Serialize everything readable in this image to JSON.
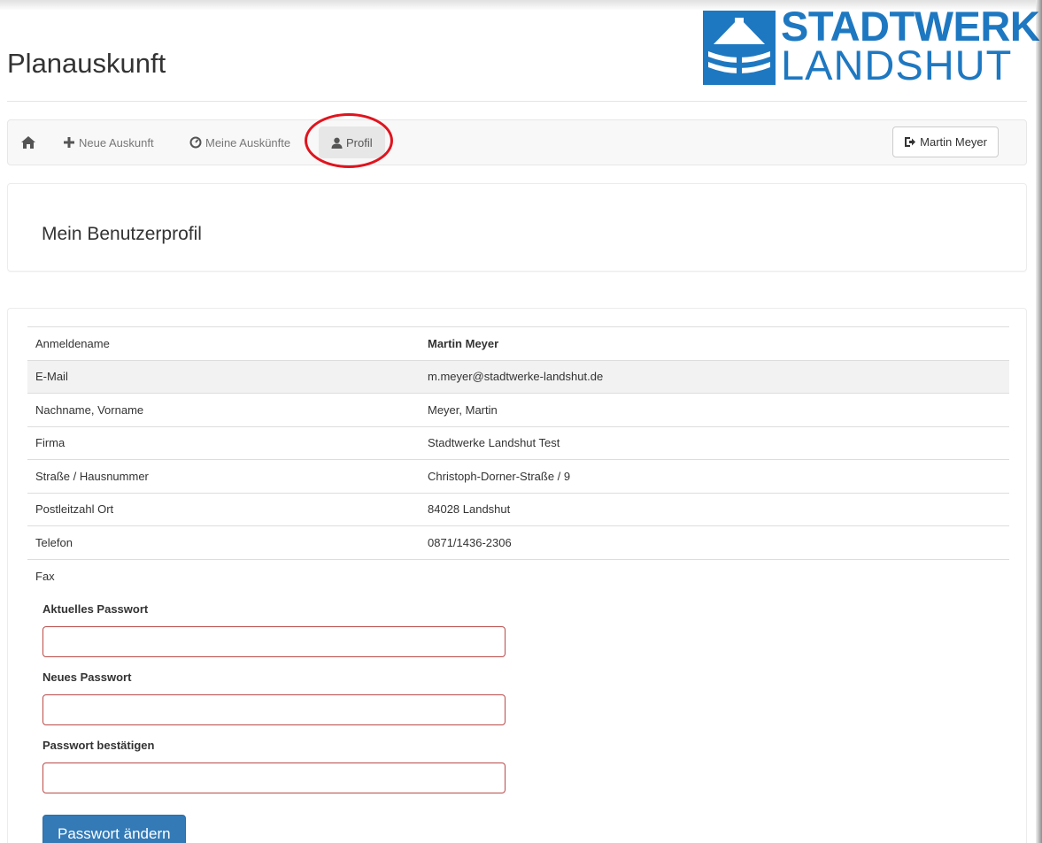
{
  "header": {
    "app_title": "Planauskunft",
    "logo_line1": "STADTWERKE",
    "logo_line2": "LANDSHUT"
  },
  "navbar": {
    "items": [
      {
        "label": "Neue Auskunft",
        "icon": "plus-icon"
      },
      {
        "label": "Meine Auskünfte",
        "icon": "dashboard-icon"
      },
      {
        "label": "Profil",
        "icon": "user-icon",
        "active": true
      }
    ],
    "user_button_label": "Martin Meyer",
    "user_button_icon": "logout-icon"
  },
  "page": {
    "heading": "Mein Benutzerprofil"
  },
  "profile": {
    "rows": [
      {
        "label": "Anmeldename",
        "value": "Martin Meyer"
      },
      {
        "label": "E-Mail",
        "value": "m.meyer@stadtwerke-landshut.de"
      },
      {
        "label": "Nachname, Vorname",
        "value": "Meyer, Martin"
      },
      {
        "label": "Firma",
        "value": "Stadtwerke Landshut Test"
      },
      {
        "label": "Straße / Hausnummer",
        "value": "Christoph-Dorner-Straße / 9"
      },
      {
        "label": "Postleitzahl Ort",
        "value": "84028 Landshut"
      },
      {
        "label": "Telefon",
        "value": "0871/1436-2306"
      },
      {
        "label": "Fax",
        "value": ""
      }
    ]
  },
  "password_form": {
    "current_label": "Aktuelles Passwort",
    "new_label": "Neues Passwort",
    "confirm_label": "Passwort bestätigen",
    "current_value": "",
    "new_value": "",
    "confirm_value": "",
    "submit_label": "Passwort ändern"
  },
  "colors": {
    "brand_blue": "#1e78c1",
    "primary_button": "#337ab7",
    "error_border": "#b94a48",
    "highlight_ring": "#e0141e"
  }
}
